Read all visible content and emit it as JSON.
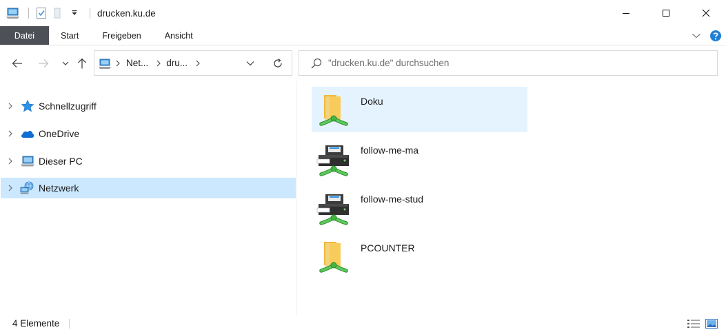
{
  "window": {
    "title": "drucken.ku.de"
  },
  "ribbon": {
    "tabs": [
      {
        "label": "Datei"
      },
      {
        "label": "Start"
      },
      {
        "label": "Freigeben"
      },
      {
        "label": "Ansicht"
      }
    ]
  },
  "address": {
    "crumbs": [
      "Net...",
      "dru..."
    ]
  },
  "search": {
    "placeholder": "\"drucken.ku.de\" durchsuchen"
  },
  "nav": {
    "items": [
      {
        "label": "Schnellzugriff",
        "icon": "star-icon"
      },
      {
        "label": "OneDrive",
        "icon": "cloud-icon"
      },
      {
        "label": "Dieser PC",
        "icon": "pc-icon"
      },
      {
        "label": "Netzwerk",
        "icon": "network-icon"
      }
    ]
  },
  "content": {
    "items": [
      {
        "label": "Doku",
        "type": "shared-folder"
      },
      {
        "label": "follow-me-ma",
        "type": "network-printer"
      },
      {
        "label": "follow-me-stud",
        "type": "network-printer"
      },
      {
        "label": "PCOUNTER",
        "type": "shared-folder"
      }
    ]
  },
  "status": {
    "count": "4 Elemente"
  },
  "colors": {
    "file_tab": "#4d5057",
    "nav_selected": "#cce8ff",
    "item_hover": "#e5f3ff",
    "folder": "#f8cc5a",
    "share_pipe": "#43b343"
  }
}
